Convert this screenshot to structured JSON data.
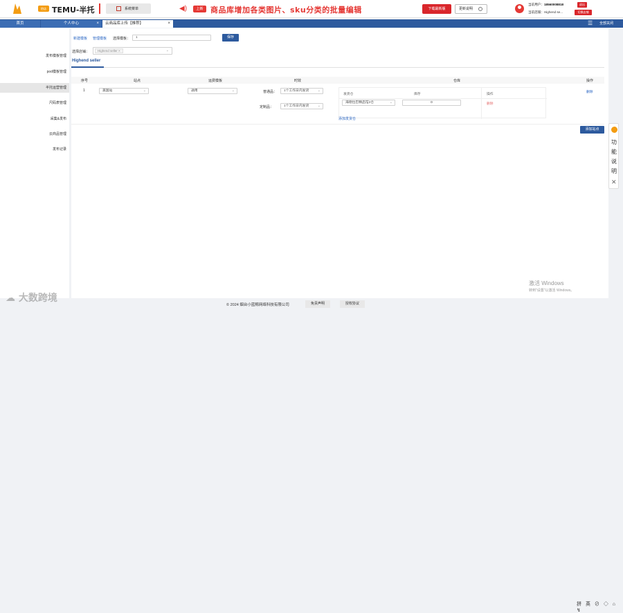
{
  "header": {
    "brand": "TEMU-半托",
    "logo2_text": "拾店",
    "system_menu": "系统菜单",
    "badge_new": "上新",
    "marquee": "商品库增加各类图片、sku分类的批量编辑",
    "download_btn": "下载最新版",
    "update_btn": "更新说明",
    "user_line1_label": "当前用户：",
    "user_phone": "18560008818",
    "user_line2": "当前店铺：Highend se...",
    "logout_btn": "退出",
    "switch_btn": "切换店铺",
    "accent": "#d9262b"
  },
  "tabs": {
    "home": "首页",
    "personal": "个人中心",
    "cloud": "云商品库上传【推荐】",
    "close_all": "全部关闭",
    "tab_color": "#2d5a9e"
  },
  "sidebar": {
    "items": [
      {
        "label": "发布模板管理"
      },
      {
        "label": "pod模板管理"
      },
      {
        "label": "半托运营管理"
      },
      {
        "label": "尺码表管理"
      },
      {
        "label": "采集&发布"
      },
      {
        "label": "云商品管理"
      },
      {
        "label": "发布记录"
      }
    ]
  },
  "main": {
    "new_template": "新建模板",
    "manage_template": "管理模板",
    "select_template_label": "选择模板：",
    "select_template_value": "1",
    "save": "保存",
    "select_shop_label": "选择店铺：",
    "shop_tag": "Highend seller",
    "shop_tab": "Highend seller",
    "table": {
      "headers": [
        "序号",
        "站点",
        "运费模板",
        "时效",
        "仓库",
        "操作"
      ],
      "row": {
        "index": "1",
        "site": "美国站",
        "freight": "通用",
        "normal_label": "普通品：",
        "normal_value": "1个工作日内发货",
        "custom_label": "定制品：",
        "custom_value": "1个工作日内发货",
        "delete": "删除"
      },
      "warehouse": {
        "headers": [
          "发货仓",
          "库存",
          "操作"
        ],
        "warehouse_value": "海德拉巴精品馆2仓",
        "stock_value": "0",
        "delete": "删除"
      },
      "add_warehouse": "添加发货仓"
    },
    "add_site": "添加站点"
  },
  "help": {
    "text": "功能说明",
    "close": "✕"
  },
  "footer": {
    "copyright": "© 2024 烟台小蓝鲸网络科技有限公司",
    "disclaimer": "免责声明",
    "license": "授权协议"
  },
  "watermark": "大数跨境",
  "windows": {
    "activate_title": "激活 Windows",
    "activate_sub": "转到\"设置\"以激活 Windows。"
  },
  "tray": "拼 英 ⊘ ◇ ⌂ ↯"
}
